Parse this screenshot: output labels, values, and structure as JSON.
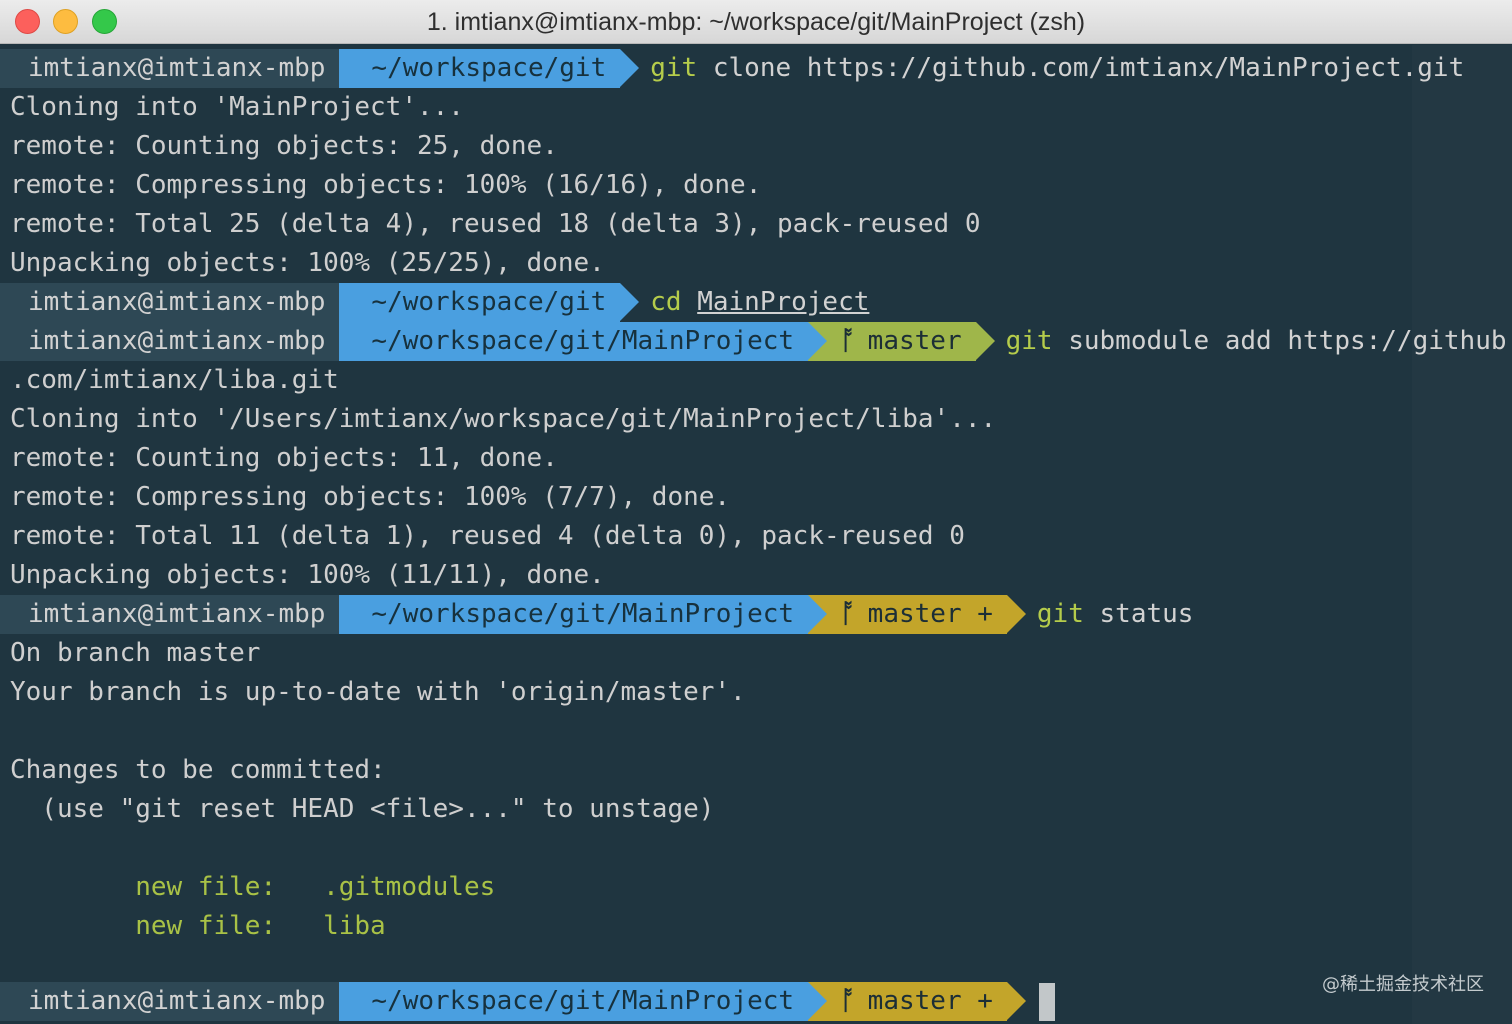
{
  "window": {
    "title": "1. imtianx@imtianx-mbp: ~/workspace/git/MainProject (zsh)"
  },
  "colors": {
    "background": "#1f3540",
    "user_segment": "#2e4855",
    "path_segment": "#4a9fe0",
    "branch_dirty": "#c3a52a",
    "branch_clean": "#9fb64a",
    "command_keyword": "#b5cc4b"
  },
  "icons": {
    "branch": "git-branch-icon"
  },
  "terminal": {
    "prompt1": {
      "user": "imtianx@imtianx-mbp",
      "path": "~/workspace/git",
      "cmd_kw": "git",
      "cmd_rest": " clone https://github.com/imtianx/MainProject.git"
    },
    "out1": [
      "Cloning into 'MainProject'...",
      "remote: Counting objects: 25, done.",
      "remote: Compressing objects: 100% (16/16), done.",
      "remote: Total 25 (delta 4), reused 18 (delta 3), pack-reused 0",
      "Unpacking objects: 100% (25/25), done."
    ],
    "prompt2": {
      "user": "imtianx@imtianx-mbp",
      "path": "~/workspace/git",
      "cmd_kw": "cd",
      "cmd_arg": "MainProject"
    },
    "prompt3": {
      "user": "imtianx@imtianx-mbp",
      "path": "~/workspace/git/MainProject",
      "branch_glyph": "ᚩ",
      "branch": "master",
      "cmd_kw": "git",
      "cmd_rest": " submodule add https://github"
    },
    "out3": [
      ".com/imtianx/liba.git",
      "Cloning into '/Users/imtianx/workspace/git/MainProject/liba'...",
      "remote: Counting objects: 11, done.",
      "remote: Compressing objects: 100% (7/7), done.",
      "remote: Total 11 (delta 1), reused 4 (delta 0), pack-reused 0",
      "Unpacking objects: 100% (11/11), done."
    ],
    "prompt4": {
      "user": "imtianx@imtianx-mbp",
      "path": "~/workspace/git/MainProject",
      "branch_glyph": "ᚩ",
      "branch": "master +",
      "cmd_kw": "git",
      "cmd_rest": " status"
    },
    "out4": {
      "line1": "On branch master",
      "line2": "Your branch is up-to-date with 'origin/master'.",
      "line3": "Changes to be committed:",
      "line4": "  (use \"git reset HEAD <file>...\" to unstage)",
      "file1": "        new file:   .gitmodules",
      "file2": "        new file:   liba"
    },
    "prompt5": {
      "user": "imtianx@imtianx-mbp",
      "path": "~/workspace/git/MainProject",
      "branch_glyph": "ᚩ",
      "branch": "master +"
    }
  },
  "watermark": "@稀土掘金技术社区"
}
